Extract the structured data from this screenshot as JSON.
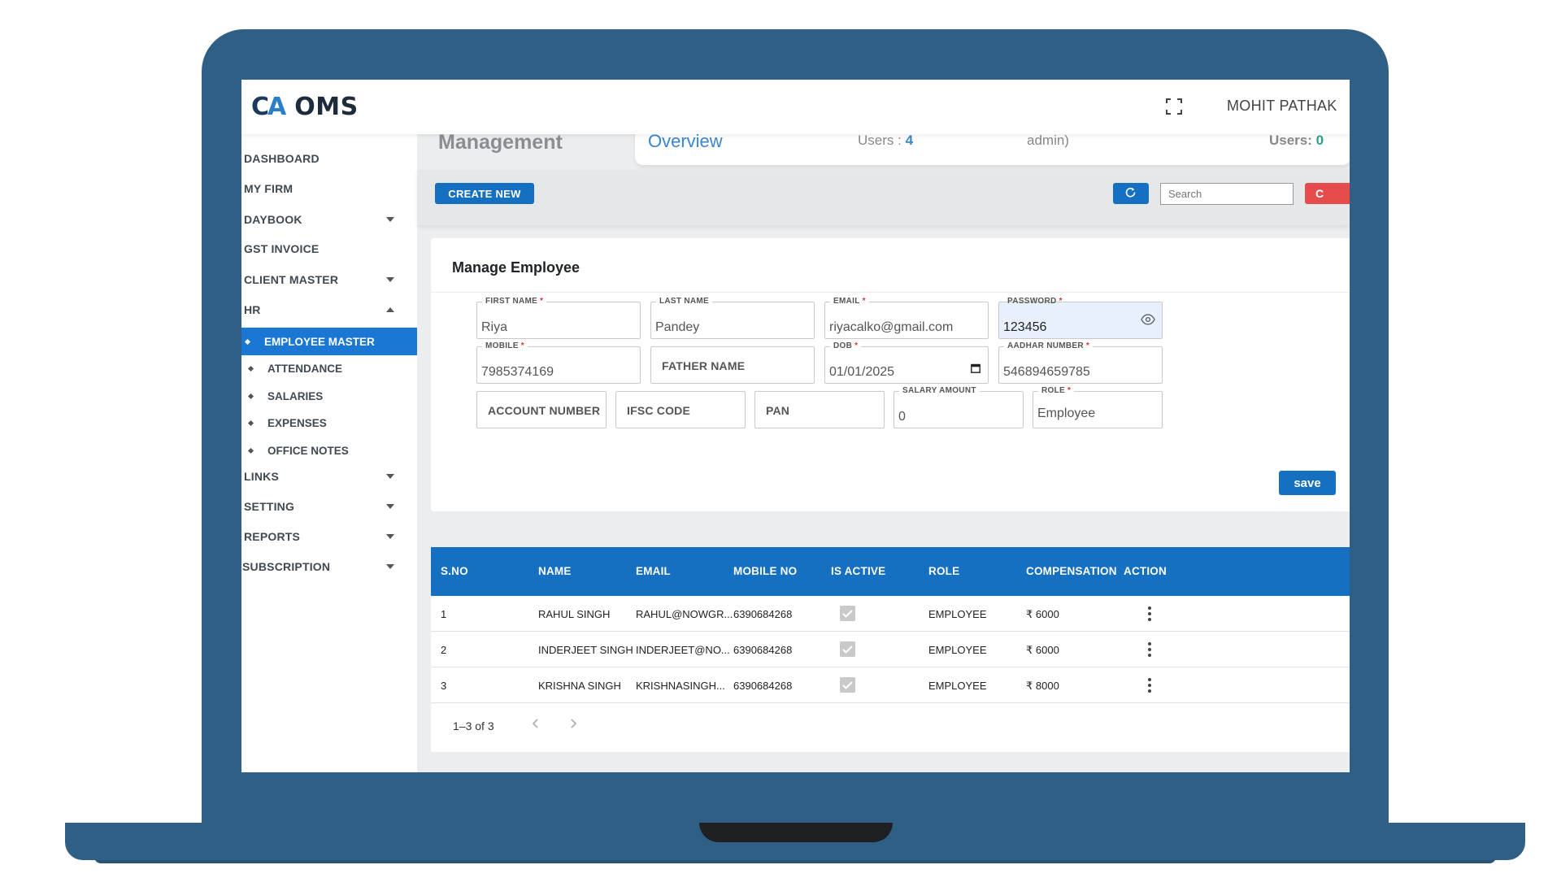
{
  "header": {
    "logo_mark_left": "C",
    "logo_mark_right": "A",
    "logo_text": "OMS",
    "user_name": "MOHIT PATHAK"
  },
  "sidebar": {
    "items": [
      {
        "label": "DASHBOARD",
        "has_caret": false
      },
      {
        "label": "MY FIRM",
        "has_caret": false
      },
      {
        "label": "DAYBOOK",
        "has_caret": true,
        "caret": "down"
      },
      {
        "label": "GST INVOICE",
        "has_caret": false
      },
      {
        "label": "CLIENT MASTER",
        "has_caret": true,
        "caret": "down"
      },
      {
        "label": "HR",
        "has_caret": true,
        "caret": "up"
      }
    ],
    "hr_sub": [
      {
        "label": "EMPLOYEE MASTER",
        "active": true
      },
      {
        "label": "ATTENDANCE",
        "active": false
      },
      {
        "label": "SALARIES",
        "active": false
      },
      {
        "label": "EXPENSES",
        "active": false
      },
      {
        "label": "OFFICE NOTES",
        "active": false
      }
    ],
    "items_after": [
      {
        "label": "LINKS",
        "caret": "down"
      },
      {
        "label": "SETTING",
        "caret": "down"
      },
      {
        "label": "REPORTS",
        "caret": "down"
      },
      {
        "label": "SUBSCRIPTION",
        "caret": "down"
      }
    ]
  },
  "top": {
    "management_title": "Management",
    "overview_title": "Overview",
    "users_label": "Users : ",
    "users_value": "4",
    "admin_text": "admin)",
    "users_right_label": "Users: ",
    "users_right_value": "0"
  },
  "toolbar": {
    "create_label": "CREATE NEW",
    "search_placeholder": "Search",
    "red_button_label": "C"
  },
  "form": {
    "title": "Manage Employee",
    "close_glyph": "›",
    "first_name": {
      "label": "FIRST NAME",
      "value": "Riya",
      "required": true
    },
    "last_name": {
      "label": "LAST NAME",
      "value": "Pandey",
      "required": false
    },
    "email": {
      "label": "EMAIL",
      "value": "riyacalko@gmail.com",
      "required": true
    },
    "password": {
      "label": "PASSWORD",
      "value": "123456",
      "required": true
    },
    "mobile": {
      "label": "MOBILE",
      "value": "7985374169",
      "required": true
    },
    "father_name": {
      "placeholder": "FATHER NAME"
    },
    "dob": {
      "label": "DOB",
      "value": "01/01/2025",
      "required": true
    },
    "aadhar": {
      "label": "AADHAR NUMBER",
      "value": "546894659785",
      "required": true
    },
    "account_number": {
      "placeholder": "ACCOUNT NUMBER"
    },
    "ifsc": {
      "placeholder": "IFSC CODE"
    },
    "pan": {
      "placeholder": "PAN"
    },
    "salary": {
      "label": "SALARY AMOUNT",
      "value": "0",
      "required": false
    },
    "role": {
      "label": "ROLE",
      "value": "Employee",
      "required": true
    },
    "required_mark": "*",
    "save_label": "save"
  },
  "table": {
    "columns": [
      "S.NO",
      "NAME",
      "EMAIL",
      "MOBILE NO",
      "IS ACTIVE",
      "ROLE",
      "COMPENSATION",
      "ACTION"
    ],
    "rows": [
      {
        "sno": "1",
        "name": "RAHUL SINGH",
        "email": "RAHUL@NOWGR...",
        "mobile": "6390684268",
        "active": true,
        "role": "EMPLOYEE",
        "comp": "₹ 6000"
      },
      {
        "sno": "2",
        "name": "INDERJEET SINGH",
        "email": "INDERJEET@NO...",
        "mobile": "6390684268",
        "active": true,
        "role": "EMPLOYEE",
        "comp": "₹ 6000"
      },
      {
        "sno": "3",
        "name": "KRISHNA SINGH",
        "email": "KRISHNASINGH...",
        "mobile": "6390684268",
        "active": true,
        "role": "EMPLOYEE",
        "comp": "₹ 8000"
      }
    ],
    "pagination": "1–3 of 3"
  },
  "colors": {
    "frame": "#2f5f85",
    "primary": "#1670c2",
    "danger": "#e74c4c",
    "required": "#e03232"
  }
}
